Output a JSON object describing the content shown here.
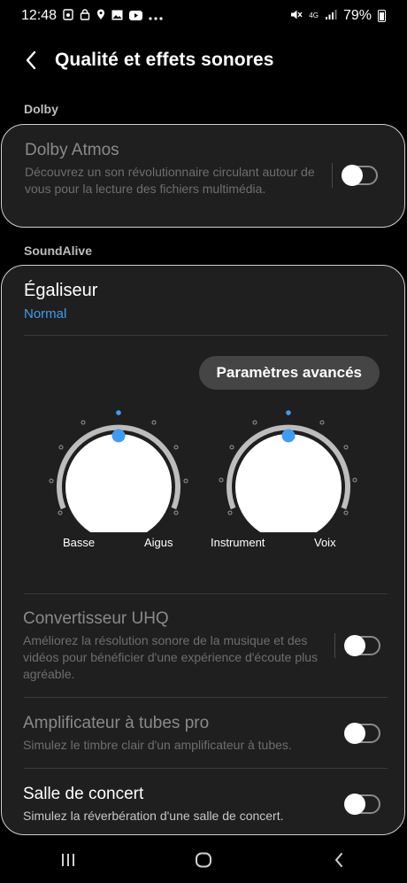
{
  "status_bar": {
    "time": "12:48",
    "left_icons": [
      "gallery-icon",
      "lock-icon",
      "location-icon",
      "image-icon",
      "youtube-icon",
      "more-dots-icon"
    ],
    "network": "4G",
    "battery": "79%"
  },
  "header": {
    "title": "Qualité et effets sonores",
    "back_icon": "chevron-left-icon"
  },
  "dolby": {
    "section": "Dolby",
    "title": "Dolby Atmos",
    "description": "Découvrez un son révolutionnaire circulant autour de vous pour la lecture des fichiers multimédia.",
    "enabled": false
  },
  "soundalive": {
    "section": "SoundAlive",
    "equalizer": {
      "title": "Égaliseur",
      "value": "Normal",
      "value_color": "#3e9cf2"
    },
    "advanced_button": "Paramètres avancés",
    "knobs": [
      {
        "left_label": "Basse",
        "right_label": "Aigus"
      },
      {
        "left_label": "Instrument",
        "right_label": "Voix"
      }
    ],
    "uhq": {
      "title": "Convertisseur UHQ",
      "description": "Améliorez la résolution sonore de la musique et des vidéos pour bénéficier d'une expérience d'écoute plus agréable.",
      "enabled": false
    },
    "tube_amp": {
      "title": "Amplificateur à tubes pro",
      "description": "Simulez le timbre clair d'un amplificateur à tubes.",
      "enabled": false
    },
    "concert_hall": {
      "title": "Salle de concert",
      "description": "Simulez la réverbération d'une salle de concert.",
      "enabled": false
    }
  },
  "nav_bar": {
    "icons": [
      "recent-apps-icon",
      "home-icon",
      "back-icon"
    ]
  },
  "colors": {
    "accent": "#3e9cf2",
    "card": "#1f1f1f",
    "background": "#000000"
  }
}
